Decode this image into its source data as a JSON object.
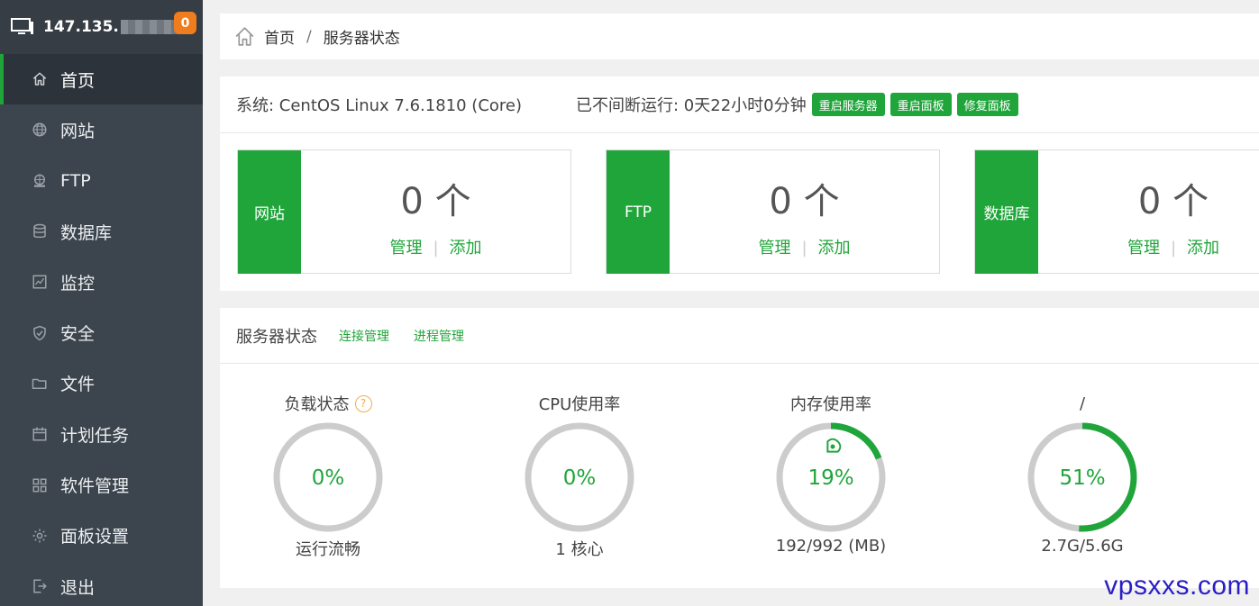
{
  "sidebar": {
    "host_prefix": "147.135.",
    "badge": "0",
    "items": [
      {
        "label": "首页",
        "icon": "home-icon",
        "active": true
      },
      {
        "label": "网站",
        "icon": "globe-icon"
      },
      {
        "label": "FTP",
        "icon": "ftp-icon"
      },
      {
        "label": "数据库",
        "icon": "database-icon"
      },
      {
        "label": "监控",
        "icon": "monitor-chart-icon"
      },
      {
        "label": "安全",
        "icon": "shield-icon"
      },
      {
        "label": "文件",
        "icon": "folder-icon"
      },
      {
        "label": "计划任务",
        "icon": "calendar-icon"
      },
      {
        "label": "软件管理",
        "icon": "grid-apps-icon"
      },
      {
        "label": "面板设置",
        "icon": "gear-icon"
      },
      {
        "label": "退出",
        "icon": "logout-icon"
      }
    ]
  },
  "breadcrumb": {
    "home": "首页",
    "separator": "/",
    "current": "服务器状态"
  },
  "system": {
    "os": "系统: CentOS Linux 7.6.1810 (Core)",
    "uptime": "已不间断运行: 0天22小时0分钟",
    "buttons": {
      "restart_server": "重启服务器",
      "restart_panel": "重启面板",
      "repair_panel": "修复面板"
    }
  },
  "stats": [
    {
      "tag": "网站",
      "count": "0 个",
      "manage": "管理",
      "add": "添加"
    },
    {
      "tag": "FTP",
      "count": "0 个",
      "manage": "管理",
      "add": "添加"
    },
    {
      "tag": "数据库",
      "count": "0 个",
      "manage": "管理",
      "add": "添加"
    }
  ],
  "server_status": {
    "title": "服务器状态",
    "links": {
      "connections": "连接管理",
      "processes": "进程管理"
    },
    "gauges": [
      {
        "title": "负载状态",
        "value": 0,
        "label": "0%",
        "footer": "运行流畅",
        "help": "?"
      },
      {
        "title": "CPU使用率",
        "value": 0,
        "label": "0%",
        "footer": "1 核心"
      },
      {
        "title": "内存使用率",
        "value": 19,
        "label": "19%",
        "footer": "192/992 (MB)",
        "icon": "rocket-icon"
      },
      {
        "title": "/",
        "value": 51,
        "label": "51%",
        "footer": "2.7G/5.6G"
      }
    ]
  },
  "colors": {
    "accent": "#20a53a",
    "sidebar": "#3c444d",
    "badge": "#f07d1d",
    "track": "#cccccc"
  },
  "watermark": "vpsxxs.com"
}
